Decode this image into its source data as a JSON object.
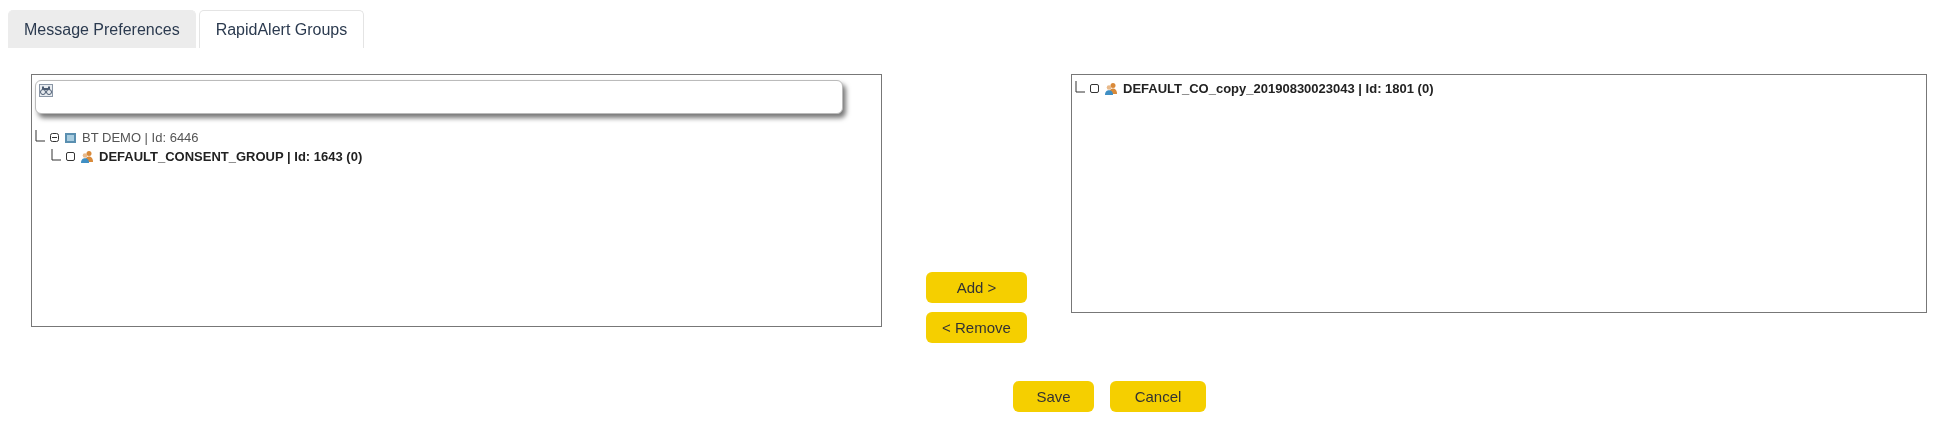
{
  "tabs": [
    {
      "label": "Message Preferences",
      "selected": false
    },
    {
      "label": "RapidAlert Groups",
      "selected": true
    }
  ],
  "available_tree": [
    {
      "kind": "organization",
      "label": "BT DEMO | Id: 6446",
      "expanded": true,
      "children": [
        {
          "kind": "group",
          "label": "DEFAULT_CONSENT_GROUP | Id: 1643 (0)",
          "checked": false
        }
      ]
    }
  ],
  "transfer_buttons": [
    "Add >",
    "< Remove"
  ],
  "selected_tree": [
    {
      "kind": "group",
      "label": "DEFAULT_CO_copy_20190830023043 | Id: 1801 (0)",
      "checked": false
    }
  ],
  "footer_buttons": [
    "Save",
    "Cancel"
  ]
}
